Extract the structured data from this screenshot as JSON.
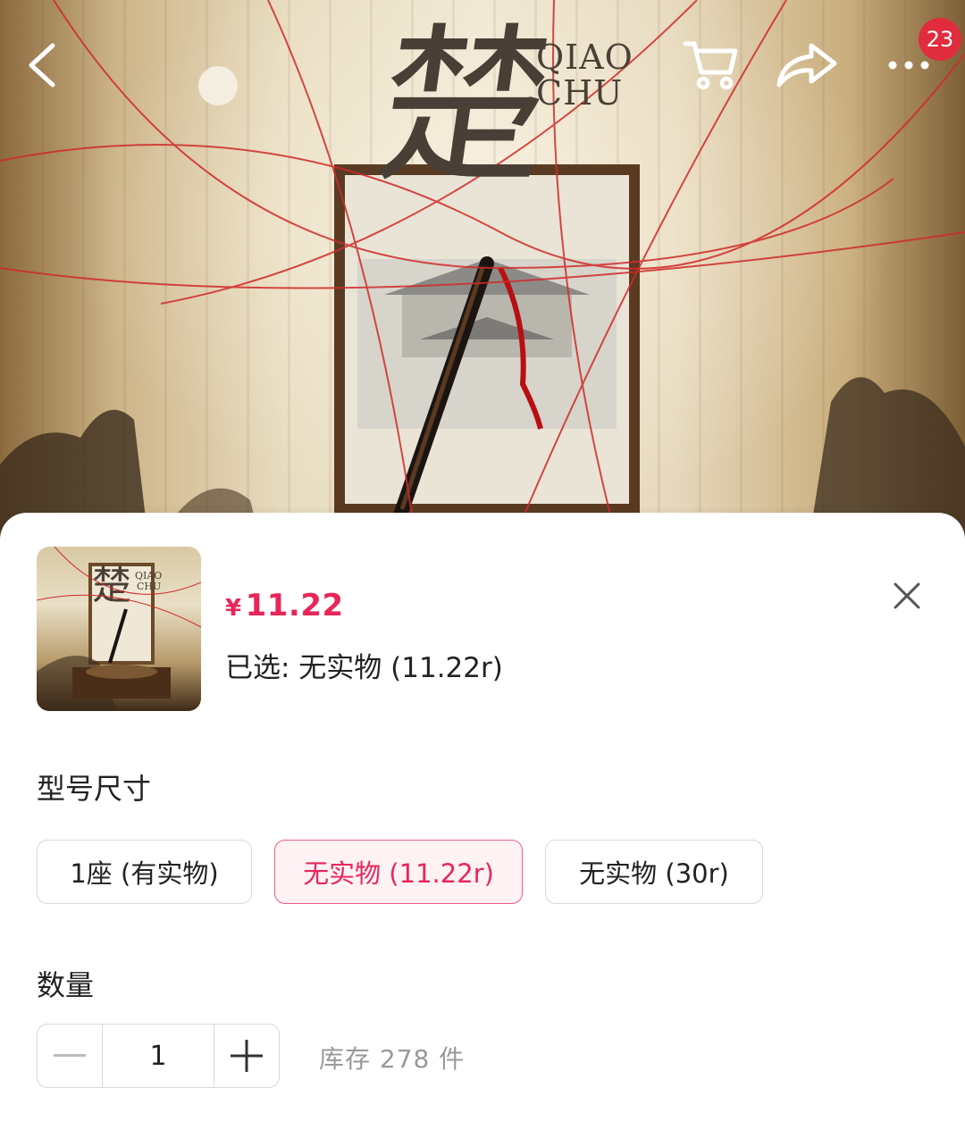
{
  "header": {
    "cart_badge": "23"
  },
  "poster": {
    "title_line1": "QIAO",
    "title_line2": "CHU",
    "calligraphy": "楚"
  },
  "product": {
    "currency": "¥",
    "price": "11.22",
    "selected_label": "已选: 无实物 (11.22r)"
  },
  "specs": {
    "label": "型号尺寸",
    "options": [
      {
        "label": "1座 (有实物)",
        "active": false
      },
      {
        "label": "无实物 (11.22r)",
        "active": true
      },
      {
        "label": "无实物 (30r)",
        "active": false
      }
    ]
  },
  "quantity": {
    "label": "数量",
    "value": "1",
    "stock": "库存 278 件"
  },
  "colors": {
    "accent": "#e8265a",
    "badge": "#e02c3d"
  }
}
